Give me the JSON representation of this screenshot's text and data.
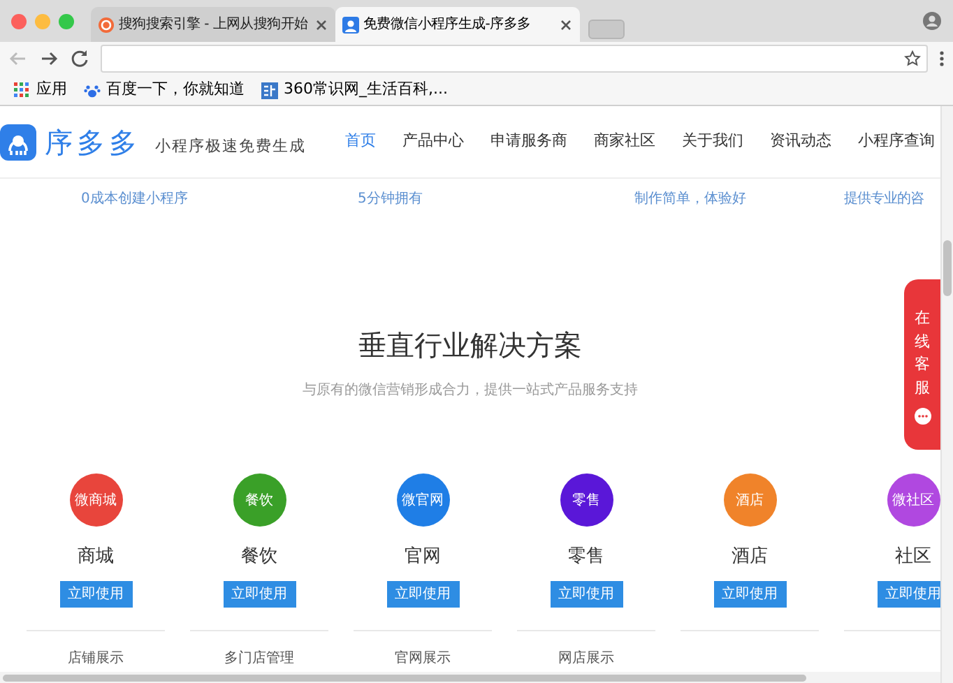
{
  "browser": {
    "tabs": [
      {
        "title": "搜狗搜索引擎 - 上网从搜狗开始",
        "selected": false
      },
      {
        "title": "免费微信小程序生成-序多多",
        "selected": true
      }
    ],
    "bookmarks": [
      {
        "label": "应用",
        "kind": "apps"
      },
      {
        "label": "百度一下，你就知道",
        "kind": "paw"
      },
      {
        "label": "360常识网_生活百科,...",
        "kind": "site"
      }
    ]
  },
  "header": {
    "logo": "序多多",
    "slogan": "小程序极速免费生成",
    "nav": [
      {
        "label": "首页",
        "selected": true
      },
      {
        "label": "产品中心",
        "selected": false
      },
      {
        "label": "申请服务商",
        "selected": false
      },
      {
        "label": "商家社区",
        "selected": false
      },
      {
        "label": "关于我们",
        "selected": false
      },
      {
        "label": "资讯动态",
        "selected": false
      },
      {
        "label": "小程序查询",
        "selected": false
      }
    ]
  },
  "features_strip": [
    "0成本创建小程序",
    "5分钟拥有",
    "制作简单，体验好",
    "提供专业的咨"
  ],
  "section": {
    "title": "垂直行业解决方案",
    "subtitle": "与原有的微信营销形成合力，提供一站式产品服务支持",
    "industries": [
      {
        "badge": "微商城",
        "name": "商城",
        "button": "立即使用",
        "feature": "店铺展示",
        "color": "#e8453c"
      },
      {
        "badge": "餐饮",
        "name": "餐饮",
        "button": "立即使用",
        "feature": "多门店管理",
        "color": "#3aa028"
      },
      {
        "badge": "微官网",
        "name": "官网",
        "button": "立即使用",
        "feature": "官网展示",
        "color": "#1f7ee6"
      },
      {
        "badge": "零售",
        "name": "零售",
        "button": "立即使用",
        "feature": "网店展示",
        "color": "#5a17d8"
      },
      {
        "badge": "酒店",
        "name": "酒店",
        "button": "立即使用",
        "color": "#f0832a"
      },
      {
        "badge": "微社区",
        "name": "社区",
        "button": "立即使用",
        "color": "#b048e0"
      }
    ]
  },
  "chat_tab": {
    "label": "在线客服"
  }
}
